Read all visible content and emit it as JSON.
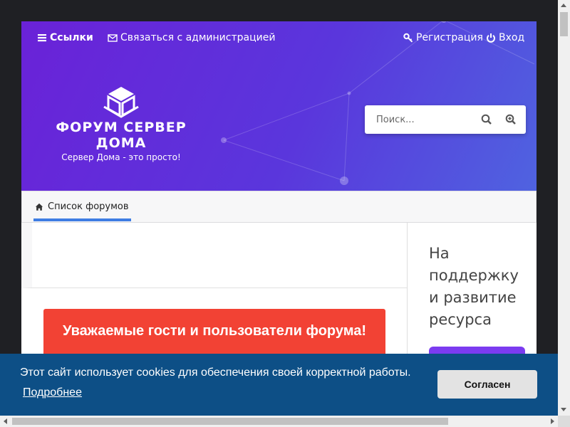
{
  "topnav": {
    "links_label": "Ссылки",
    "contact_label": "Связаться с администрацией",
    "register_label": "Регистрация",
    "login_label": "Вход"
  },
  "logo": {
    "title": "ФОРУМ СЕРВЕР ДОМА",
    "subtitle": "Сервер Дома - это просто!"
  },
  "search": {
    "placeholder": "Поиск..."
  },
  "tabs": {
    "forum_list": "Список форумов"
  },
  "notice": {
    "text": "Уважаемые гости и пользователи форума!"
  },
  "sidebar": {
    "title": "На поддержку и развитие ресурса"
  },
  "cookie": {
    "message": "Этот сайт использует cookies для обеспечения своей корректной работы.",
    "more_link": "Подробнее",
    "accept_button": "Согласен"
  },
  "colors": {
    "header_gradient_start": "#6a22d8",
    "header_gradient_end": "#4f63e0",
    "tab_accent": "#3f7de3",
    "notice_bg": "#f24234",
    "cookie_bg": "#0d4f86",
    "sidebar_button": "#7b3bf0"
  },
  "icons": {
    "links": "bars-icon",
    "contact": "envelope-icon",
    "register": "key-icon",
    "login": "power-icon",
    "search": "magnifier-icon",
    "advanced_search": "zoom-in-icon",
    "home": "home-icon",
    "logo": "cube-icon"
  }
}
